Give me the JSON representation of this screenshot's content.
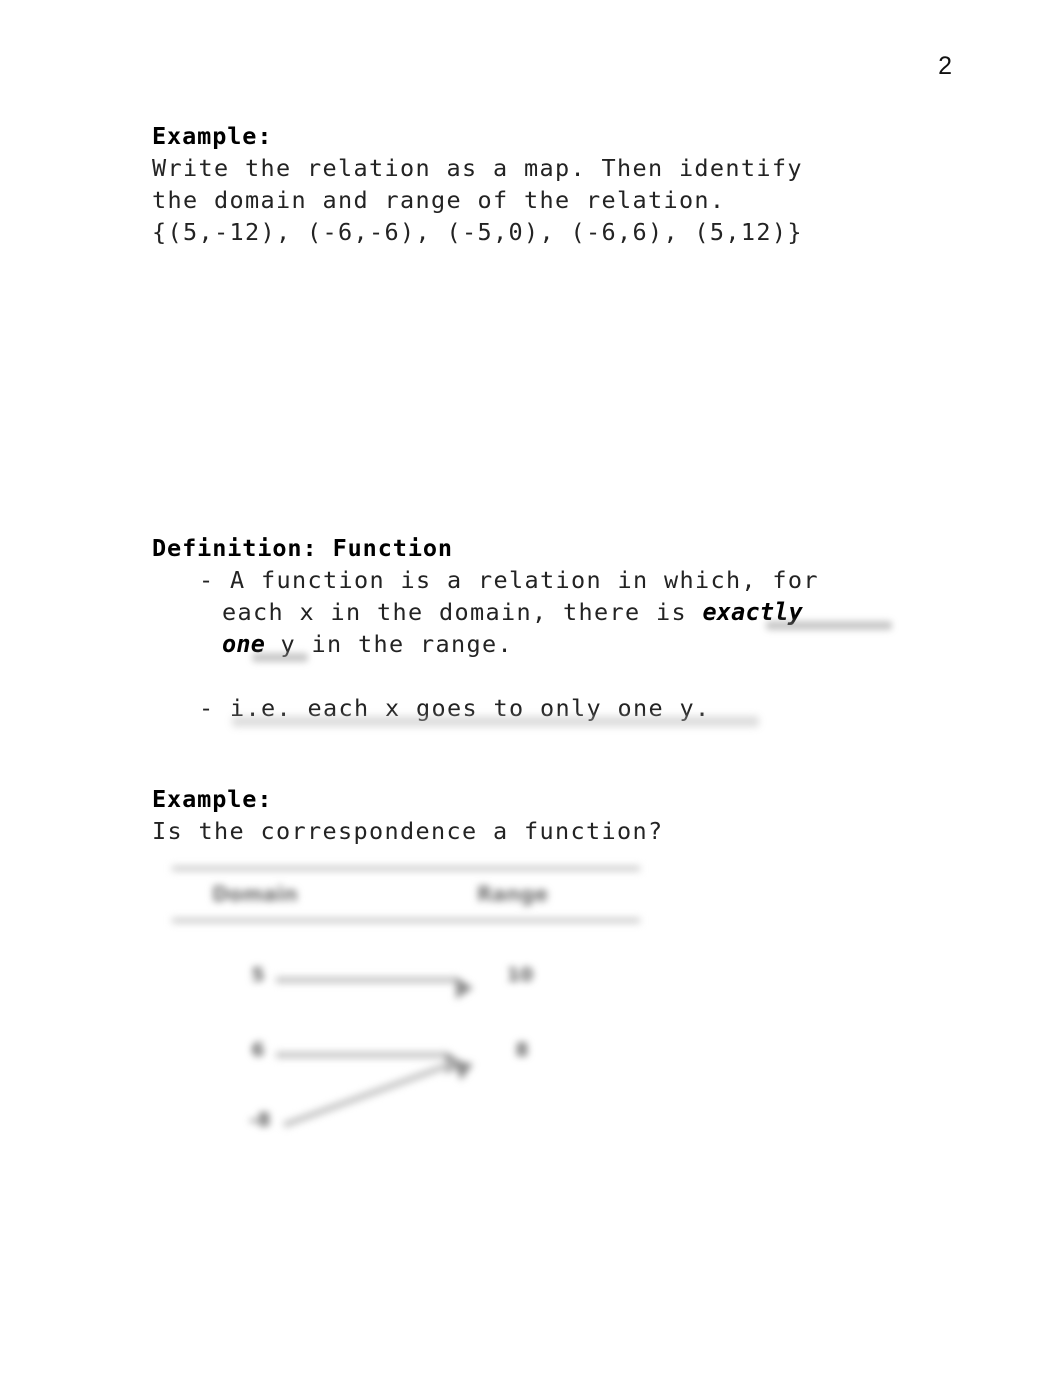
{
  "page": {
    "number": "2"
  },
  "sections": {
    "example1": {
      "heading": "Example:",
      "lines": [
        "Write the relation as a map. Then identify",
        "the domain and range of the relation.",
        "{(5,-12), (-6,-6), (-5,0), (-6,6), (5,12)}"
      ]
    },
    "definition": {
      "heading": "Definition: Function",
      "bullet1": {
        "line1": "- A function is a relation in which, for",
        "line2_prefix": "each x in the domain, there is ",
        "line2_emphasis": "exactly",
        "line3_emphasis": "one",
        "line3_suffix": " y in the range."
      },
      "bullet2": {
        "line1": "- i.e. each x goes to only one y."
      }
    },
    "example2": {
      "heading": "Example:",
      "lines": [
        "Is the correspondence a function?"
      ]
    }
  },
  "diagram": {
    "column_headers": {
      "domain": "Domain",
      "range": "Range"
    },
    "domain_nodes": [
      "5",
      "6",
      "-8"
    ],
    "range_nodes": [
      "10",
      "8"
    ],
    "mappings": [
      {
        "from": "5",
        "to": "10"
      },
      {
        "from": "6",
        "to": "8"
      },
      {
        "from": "-8",
        "to": "8"
      }
    ]
  },
  "colors": {
    "text": "#232323",
    "heading": "#000000",
    "rule": "#c9c9c9",
    "arrow": "#c2c2c2",
    "arrowhead": "#8d8d8d",
    "node": "#5e5e5e",
    "smudge": "#9a9a9a",
    "background": "#ffffff"
  }
}
